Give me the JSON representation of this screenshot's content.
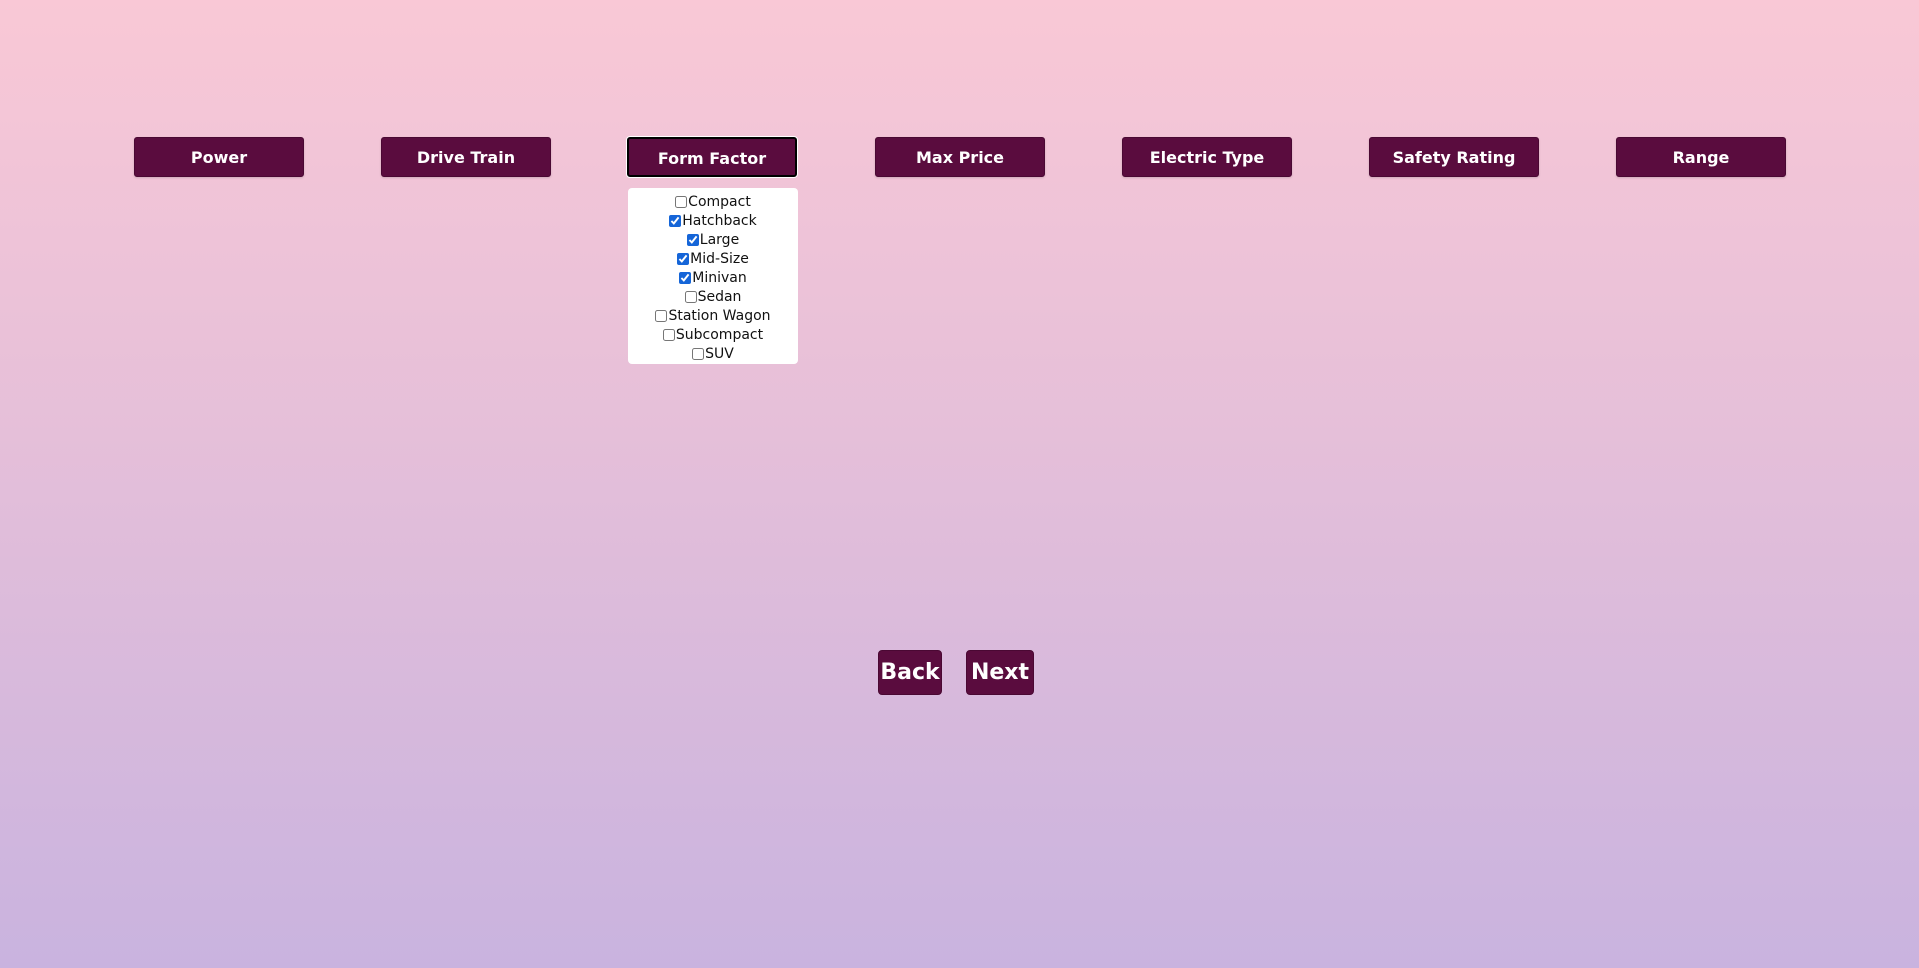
{
  "filters": {
    "buttons": [
      {
        "label": "Power"
      },
      {
        "label": "Drive Train"
      },
      {
        "label": "Form Factor"
      },
      {
        "label": "Max Price"
      },
      {
        "label": "Electric Type"
      },
      {
        "label": "Safety Rating"
      },
      {
        "label": "Range"
      }
    ],
    "active": "Form Factor"
  },
  "form_factor_dropdown": {
    "options": [
      {
        "label": "Compact",
        "checked": false
      },
      {
        "label": "Hatchback",
        "checked": true
      },
      {
        "label": "Large",
        "checked": true
      },
      {
        "label": "Mid-Size",
        "checked": true
      },
      {
        "label": "Minivan",
        "checked": true
      },
      {
        "label": "Sedan",
        "checked": false
      },
      {
        "label": "Station Wagon",
        "checked": false
      },
      {
        "label": "Subcompact",
        "checked": false
      },
      {
        "label": "SUV",
        "checked": false
      }
    ]
  },
  "navigation": {
    "back_label": "Back",
    "next_label": "Next"
  },
  "colors": {
    "button_bg": "#5a0c3e",
    "button_text": "#ffffff",
    "gradient_top": "#f9c8d6",
    "gradient_bottom": "#c9b3df",
    "checkbox_accent": "#1565d8"
  }
}
